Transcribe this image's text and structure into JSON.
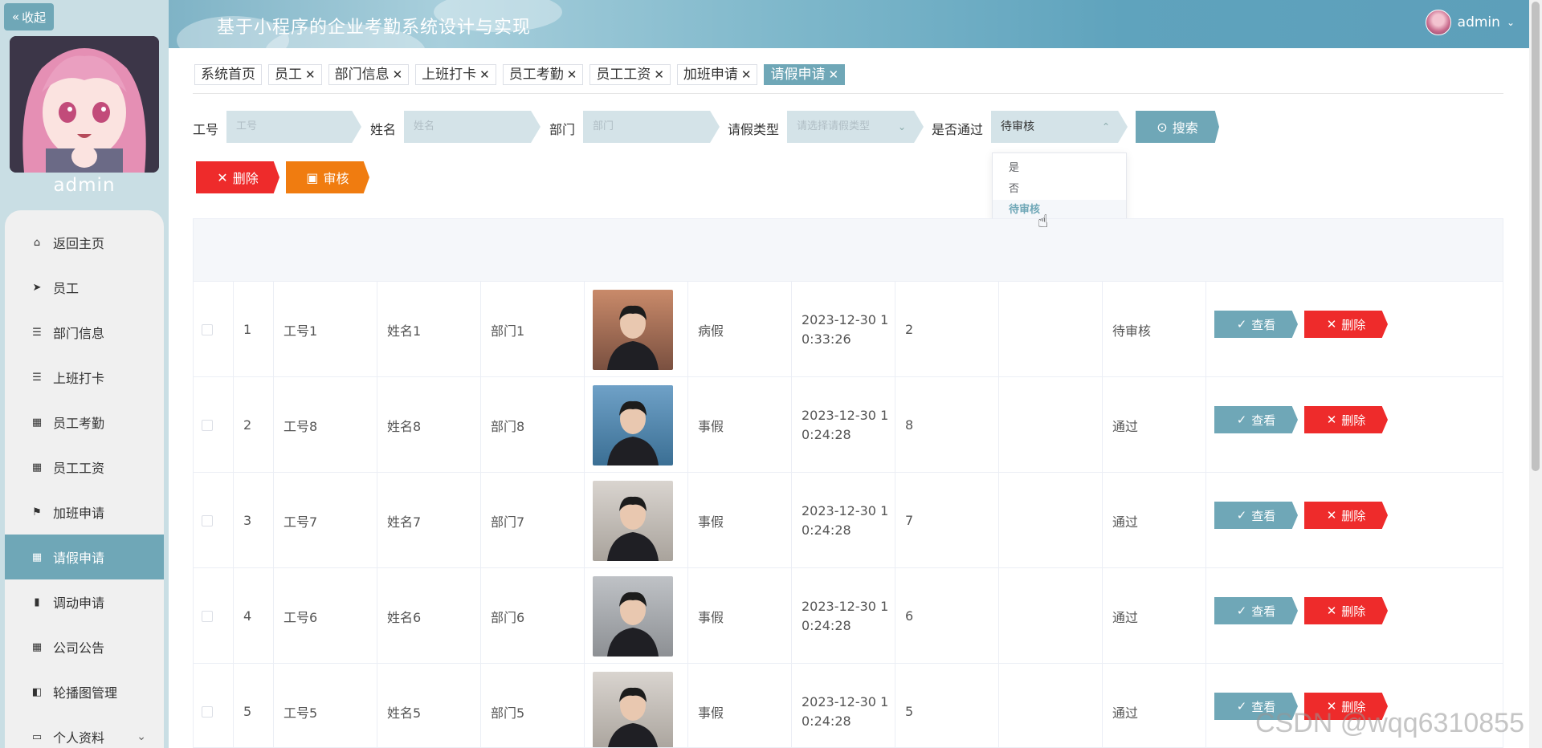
{
  "header": {
    "title": "基于小程序的企业考勤系统设计与实现",
    "user": "admin"
  },
  "sidebar": {
    "collapse_label": "收起",
    "admin_name": "admin",
    "items": [
      {
        "label": "返回主页",
        "icon": "home-icon",
        "glyph": "⌂"
      },
      {
        "label": "员工",
        "icon": "send-icon",
        "glyph": "➤"
      },
      {
        "label": "部门信息",
        "icon": "list-icon",
        "glyph": "☰"
      },
      {
        "label": "上班打卡",
        "icon": "list-icon",
        "glyph": "☰"
      },
      {
        "label": "员工考勤",
        "icon": "grid-icon",
        "glyph": "▦"
      },
      {
        "label": "员工工资",
        "icon": "grid-icon",
        "glyph": "▦"
      },
      {
        "label": "加班申请",
        "icon": "flag-icon",
        "glyph": "⚑"
      },
      {
        "label": "请假申请",
        "icon": "grid-icon",
        "glyph": "▦"
      },
      {
        "label": "调动申请",
        "icon": "bar-chart-icon",
        "glyph": "▮"
      },
      {
        "label": "公司公告",
        "icon": "grid-icon",
        "glyph": "▦"
      },
      {
        "label": "轮播图管理",
        "icon": "ticket-icon",
        "glyph": "◧"
      },
      {
        "label": "个人资料",
        "icon": "card-icon",
        "glyph": "▭"
      }
    ]
  },
  "tabs": [
    {
      "label": "系统首页",
      "closable": false
    },
    {
      "label": "员工",
      "closable": true
    },
    {
      "label": "部门信息",
      "closable": true
    },
    {
      "label": "上班打卡",
      "closable": true
    },
    {
      "label": "员工考勤",
      "closable": true
    },
    {
      "label": "员工工资",
      "closable": true
    },
    {
      "label": "加班申请",
      "closable": true
    },
    {
      "label": "请假申请",
      "closable": true
    }
  ],
  "tab_close_glyph": "✕",
  "search": {
    "gonghao_label": "工号",
    "gonghao_placeholder": "工号",
    "xingming_label": "姓名",
    "xingming_placeholder": "姓名",
    "bumen_label": "部门",
    "bumen_placeholder": "部门",
    "leixing_label": "请假类型",
    "leixing_placeholder": "请选择请假类型",
    "tongguo_label": "是否通过",
    "tongguo_value": "待审核",
    "button": "搜索"
  },
  "dropdown_options": [
    "是",
    "否",
    "待审核"
  ],
  "actions": {
    "delete": "删除",
    "audit": "审核"
  },
  "row_actions": {
    "view": "查看",
    "delete": "删除"
  },
  "rows": [
    {
      "idx": "1",
      "gonghao": "工号1",
      "xingming": "姓名1",
      "bumen": "部门1",
      "type": "病假",
      "time1": "2023-12-30 1",
      "time2": "0:33:26",
      "days": "2",
      "status": "待审核"
    },
    {
      "idx": "2",
      "gonghao": "工号8",
      "xingming": "姓名8",
      "bumen": "部门8",
      "type": "事假",
      "time1": "2023-12-30 1",
      "time2": "0:24:28",
      "days": "8",
      "status": "通过"
    },
    {
      "idx": "3",
      "gonghao": "工号7",
      "xingming": "姓名7",
      "bumen": "部门7",
      "type": "事假",
      "time1": "2023-12-30 1",
      "time2": "0:24:28",
      "days": "7",
      "status": "通过"
    },
    {
      "idx": "4",
      "gonghao": "工号6",
      "xingming": "姓名6",
      "bumen": "部门6",
      "type": "事假",
      "time1": "2023-12-30 1",
      "time2": "0:24:28",
      "days": "6",
      "status": "通过"
    },
    {
      "idx": "5",
      "gonghao": "工号5",
      "xingming": "姓名5",
      "bumen": "部门5",
      "type": "事假",
      "time1": "2023-12-30 1",
      "time2": "0:24:28",
      "days": "5",
      "status": "通过"
    }
  ],
  "watermark": "CSDN @wqq6310855",
  "colors": {
    "accent": "#6fa7b7",
    "danger": "#ee2b2b",
    "warning": "#f07c10"
  }
}
